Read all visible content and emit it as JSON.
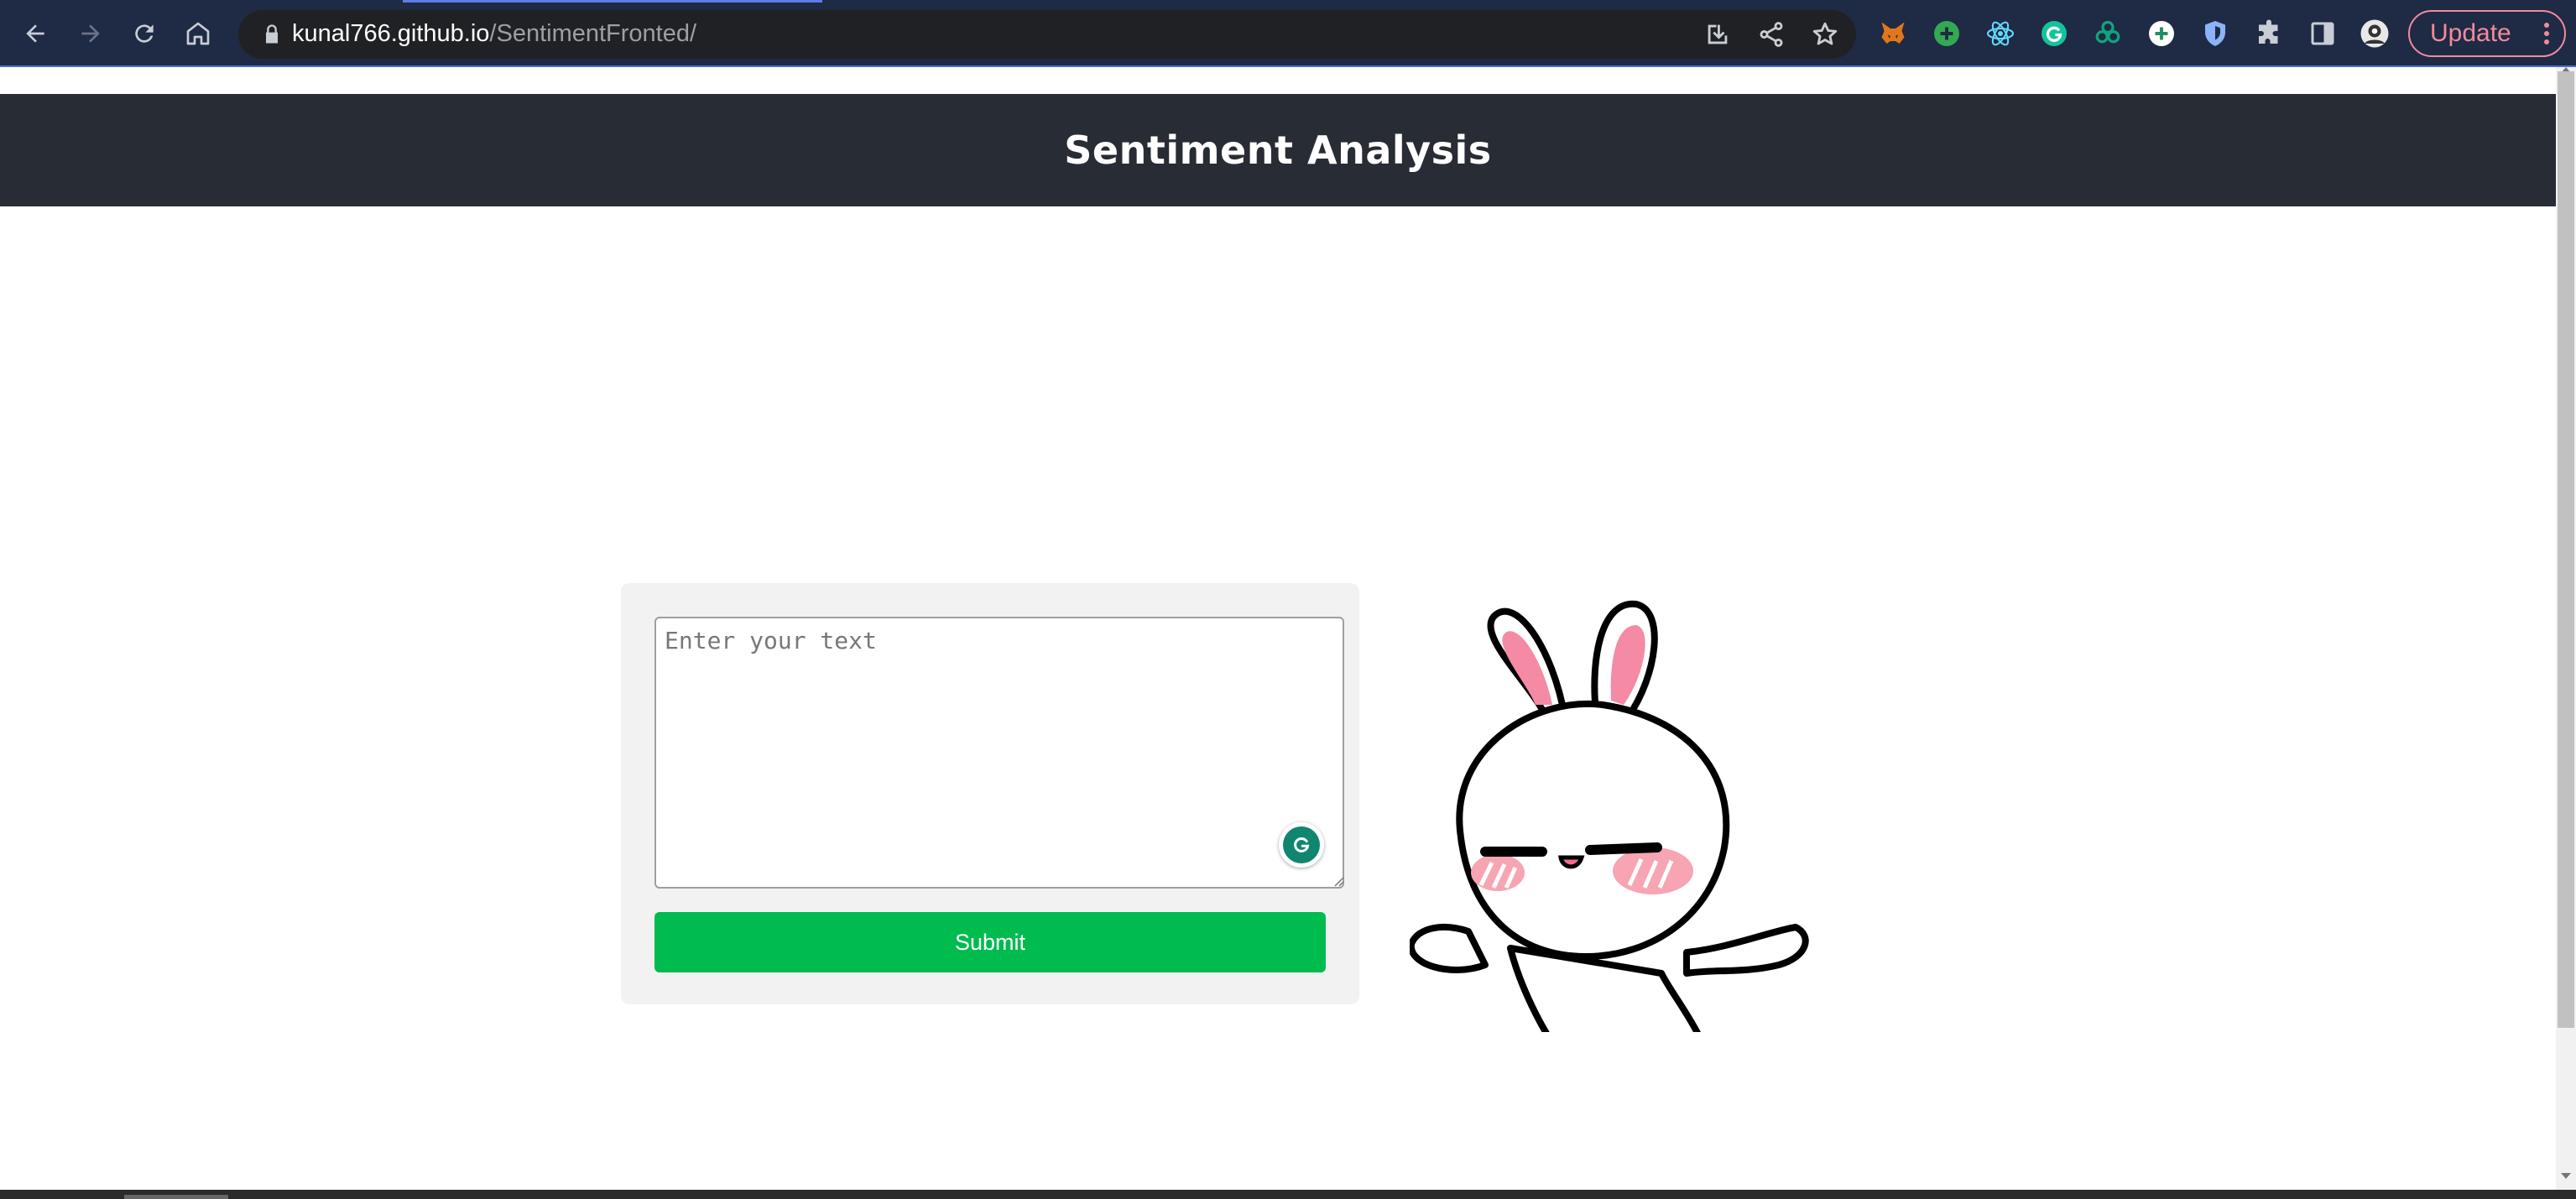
{
  "browser": {
    "url_host": "kunal766.github.io",
    "url_path": "/SentimentFronted/",
    "update_label": "Update",
    "extensions": [
      "metamask-fox-icon",
      "green-plus-icon",
      "react-atom-icon",
      "grammarly-icon",
      "chatgpt-icon",
      "plus-circle-icon",
      "shield-icon",
      "puzzle-icon",
      "side-panel-icon",
      "profile-avatar-icon"
    ]
  },
  "header": {
    "title": "Sentiment Analysis"
  },
  "form": {
    "textarea_placeholder": "Enter your text",
    "textarea_value": "",
    "submit_label": "Submit"
  },
  "colors": {
    "header_bg": "#282c34",
    "submit_bg": "#00bb4e",
    "card_bg": "#f2f2f2",
    "browser_bg": "#1f2a44",
    "update_accent": "#f28b9b"
  }
}
